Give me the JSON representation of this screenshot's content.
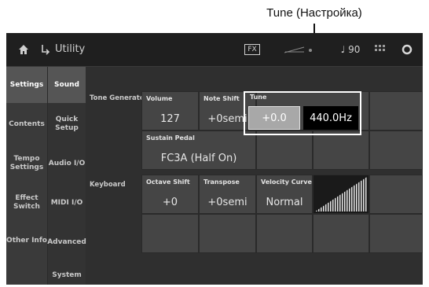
{
  "callout": {
    "label": "Tune (Настройка)"
  },
  "topbar": {
    "title": "Utility",
    "fx_label": "FX",
    "tempo": "♩ 90"
  },
  "left_tabs": [
    "Settings",
    "Contents",
    "Tempo Settings",
    "Effect Switch",
    "Other Info"
  ],
  "sub_tabs": [
    "Sound",
    "Quick Setup",
    "Audio I/O",
    "MIDI I/O",
    "Advanced",
    "System"
  ],
  "sections": {
    "tone_generator": "Tone Generator",
    "keyboard": "Keyboard"
  },
  "tone_generator": {
    "volume": {
      "label": "Volume",
      "value": "127"
    },
    "note_shift": {
      "label": "Note Shift",
      "value": "+0semi"
    },
    "tune": {
      "label": "Tune",
      "value": "+0.0",
      "hz": "440.0Hz"
    },
    "sustain_pedal": {
      "label": "Sustain Pedal",
      "value": "FC3A (Half On)"
    }
  },
  "keyboard": {
    "octave_shift": {
      "label": "Octave Shift",
      "value": "+0"
    },
    "transpose": {
      "label": "Transpose",
      "value": "+0semi"
    },
    "velocity_curve": {
      "label": "Velocity Curve",
      "value": "Normal"
    }
  }
}
